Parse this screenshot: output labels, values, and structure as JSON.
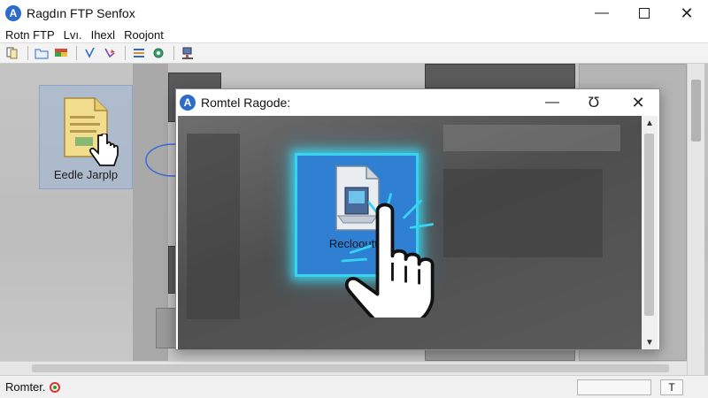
{
  "window": {
    "logo_letter": "A",
    "title": "Ragdın FTP Senfox",
    "minimize_glyph": "—",
    "close_glyph": "✕"
  },
  "menu": {
    "items": [
      "Rotn FTP",
      "Lvı.",
      "Ihexl",
      "Roojont"
    ]
  },
  "toolbar": {
    "icons": [
      "page-copy-icon",
      "folder-icon",
      "color-grid-icon",
      "download-arrow-icon",
      "upload-arrow-icon",
      "list-icon",
      "settings-gear-icon",
      "network-icon"
    ]
  },
  "workspace": {
    "desktop_file_label": "Eedle Jarplp"
  },
  "dialog": {
    "logo_letter": "A",
    "title": "Romtel Ragode:",
    "minimize_glyph": "—",
    "refresh_glyph": "Ʊ",
    "close_glyph": "✕",
    "remote_item_label": "Reclooutte",
    "scroll_up_glyph": "▲",
    "scroll_down_glyph": "▼"
  },
  "statusbar": {
    "text": "Romter.",
    "button_label": "T"
  },
  "colors": {
    "accent_blue": "#2d6cc9",
    "tile_blue": "#2f7fd2",
    "glow_cyan": "#37d4ef",
    "status_red": "#dd3333",
    "status_green": "#2ca02c"
  }
}
